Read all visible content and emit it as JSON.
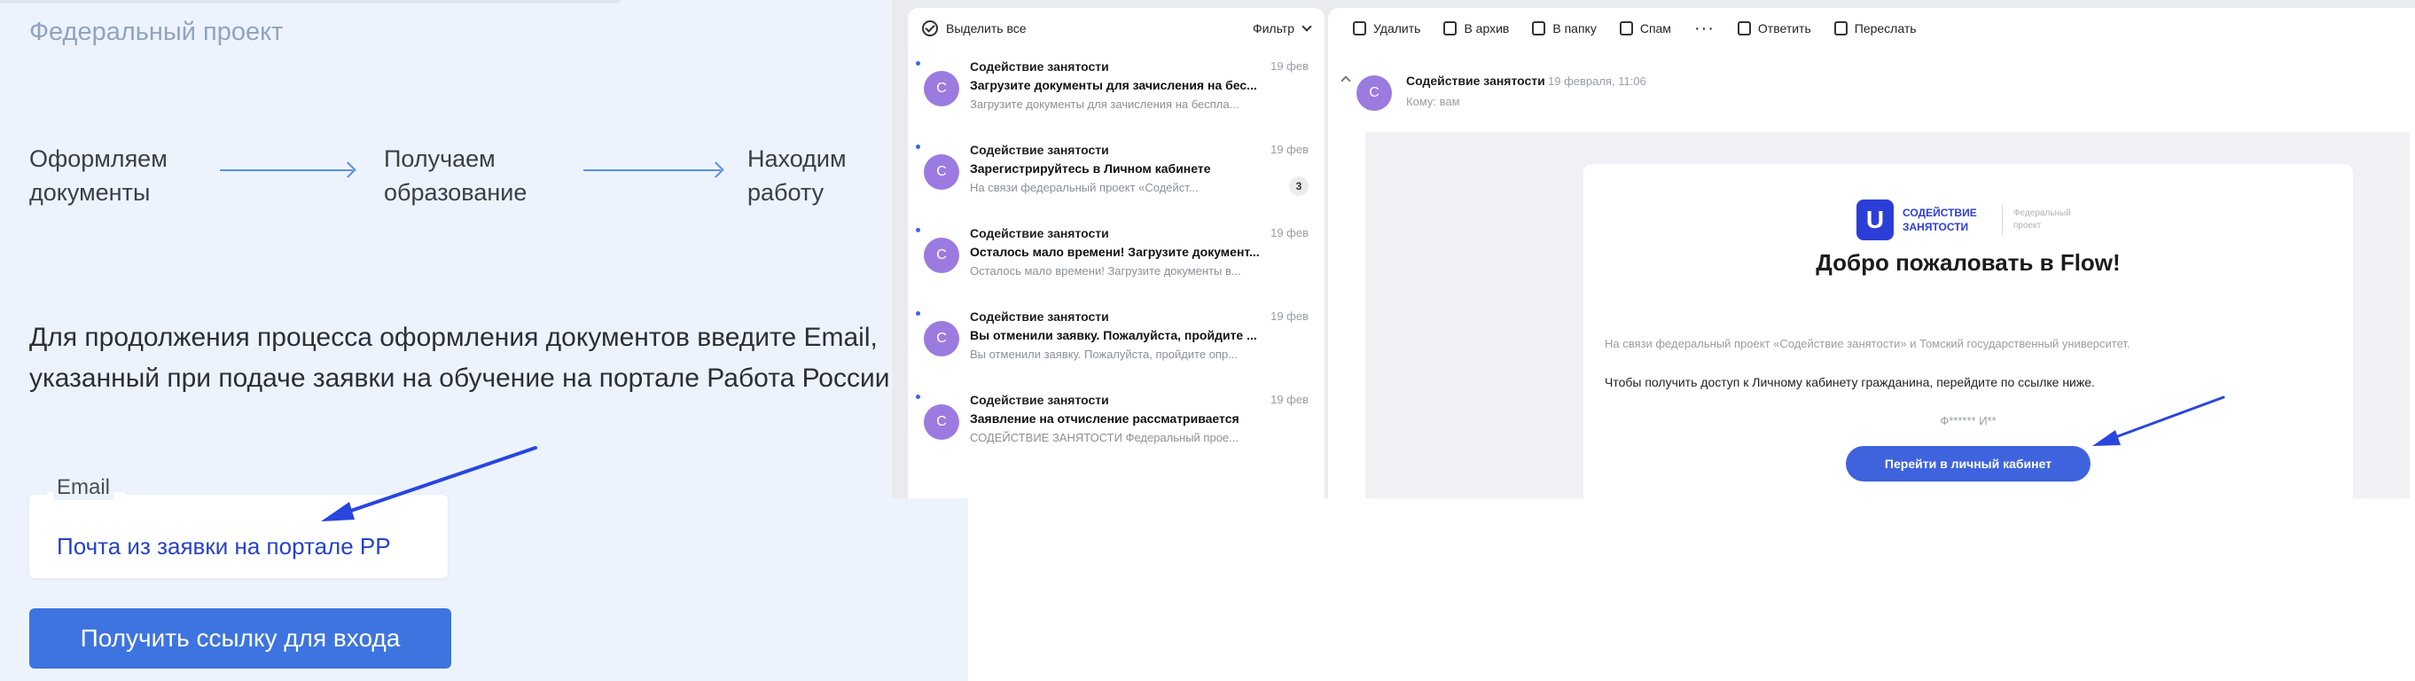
{
  "left": {
    "subtitle": "Федеральный проект",
    "steps": [
      {
        "line1": "Оформляем",
        "line2": "документы"
      },
      {
        "line1": "Получаем",
        "line2": "образование"
      },
      {
        "line1": "Находим",
        "line2": "работу"
      }
    ],
    "instruction": "Для продолжения процесса оформления документов введите Email, указанный при подаче заявки на обучение на портале Работа России",
    "email_label": "Email",
    "email_value": "Почта из заявки на портале РР",
    "submit_label": "Получить ссылку для входа"
  },
  "mail": {
    "list_toolbar": {
      "select_all": "Выделить все",
      "filter": "Фильтр"
    },
    "items": [
      {
        "avatar": "С",
        "sender": "Содействие занятости",
        "date": "19 фев",
        "subject": "Загрузите документы для зачисления на бес...",
        "preview": "Загрузите документы для зачисления на беспла..."
      },
      {
        "avatar": "С",
        "sender": "Содействие занятости",
        "date": "19 фев",
        "subject": "Зарегистрируйтесь в Личном кабинете",
        "preview": "На связи федеральный проект «Содейст...",
        "count": "3"
      },
      {
        "avatar": "С",
        "sender": "Содействие занятости",
        "date": "19 фев",
        "subject": "Осталось мало времени! Загрузите документ...",
        "preview": "Осталось мало времени! Загрузите документы в..."
      },
      {
        "avatar": "С",
        "sender": "Содействие занятости",
        "date": "19 фев",
        "subject": "Вы отменили заявку. Пожалуйста, пройдите ...",
        "preview": "Вы отменили заявку. Пожалуйста, пройдите опр..."
      },
      {
        "avatar": "С",
        "sender": "Содействие занятости",
        "date": "19 фев",
        "subject": "Заявление на отчисление рассматривается",
        "preview": "СОДЕЙСТВИЕ ЗАНЯТОСТИ Федеральный прое..."
      }
    ],
    "view_toolbar": {
      "delete": "Удалить",
      "archive": "В архив",
      "move": "В папку",
      "spam": "Спам",
      "more": "···",
      "reply": "Ответить",
      "forward": "Переслать"
    },
    "message": {
      "avatar": "С",
      "sender": "Содействие занятости",
      "datetime": "19 февраля, 11:06",
      "to": "Кому: вам",
      "brand_letter": "U",
      "brand_name": "СОДЕЙСТВИЕ ЗАНЯТОСТИ",
      "brand_sub": "Федеральный проект",
      "welcome": "Добро пожаловать в Flow!",
      "line1": "На связи федеральный проект «Содействие занятости» и Томский государственный университет.",
      "line2": "Чтобы получить доступ к Личному кабинету гражданина, перейдите по ссылке ниже.",
      "signature": "Ф****** И**",
      "button": "Перейти в личный кабинет"
    }
  },
  "colors": {
    "accent": "#3e74df",
    "arrow": "#2845e0",
    "avatar": "#9b7be0",
    "brand": "#2c3ed8"
  }
}
